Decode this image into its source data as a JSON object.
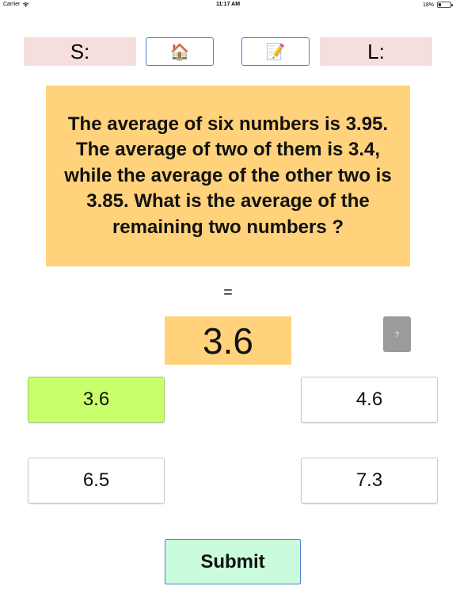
{
  "status_bar": {
    "carrier": "Carrier",
    "time": "11:17 AM",
    "battery": "18%",
    "battery_level": 0.18
  },
  "scores": {
    "s_label": "S:",
    "l_label": "L:"
  },
  "toolbar": {
    "home_icon": "🏠",
    "notes_icon": "📝"
  },
  "question": {
    "lines": [
      "The average of six numbers is 3.95.",
      "The average of two of them is 3.4,",
      "while the average of the other two is",
      "3.85. What is the average of the",
      "remaining two numbers ?"
    ]
  },
  "equals_sign": "=",
  "answer": {
    "value": "3.6"
  },
  "hint": {
    "label": "?"
  },
  "options": [
    {
      "label": "3.6",
      "selected": true
    },
    {
      "label": "4.6",
      "selected": false
    },
    {
      "label": "6.5",
      "selected": false
    },
    {
      "label": "7.3",
      "selected": false
    }
  ],
  "submit_label": "Submit",
  "colors": {
    "question_bg": "#ffd27b",
    "score_bg": "#f6dedd",
    "selected_option": "#c9ff6a",
    "submit_bg": "#c9fbdc",
    "button_border": "#4f7fd6",
    "hint_bg": "#9b9b9b"
  }
}
